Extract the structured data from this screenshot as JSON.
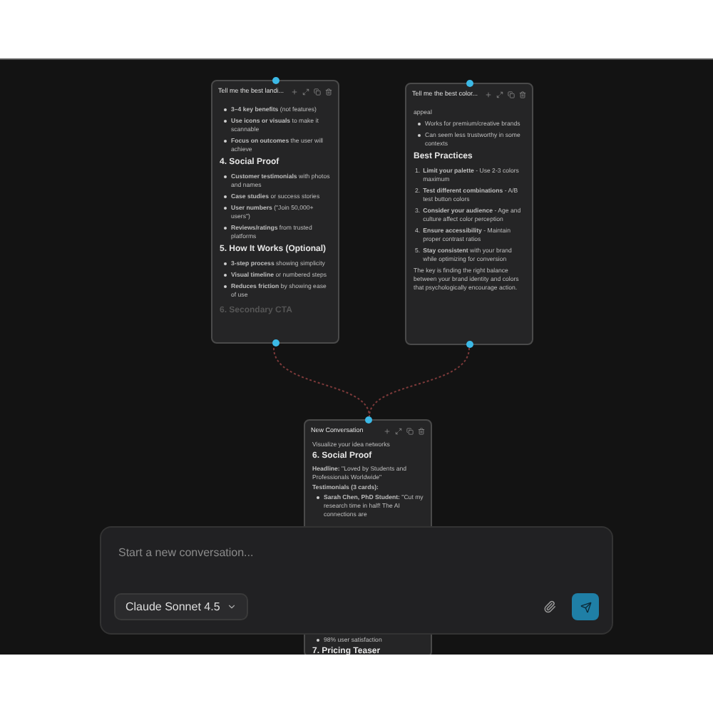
{
  "nodes": [
    {
      "title": "Tell me the best landi...",
      "blocks": [
        {
          "kind": "bullet",
          "text": "**3–4 key benefits** (not features)"
        },
        {
          "kind": "bullet",
          "text": "**Use icons or visuals** to make it scannable"
        },
        {
          "kind": "bullet",
          "text": "**Focus on outcomes** the user will achieve"
        },
        {
          "kind": "heading",
          "text": "4. Social Proof"
        },
        {
          "kind": "bullet",
          "text": "**Customer testimonials** with photos and names"
        },
        {
          "kind": "bullet",
          "text": "**Case studies** or success stories"
        },
        {
          "kind": "bullet",
          "text": "**User numbers** (\"Join 50,000+ users\")"
        },
        {
          "kind": "bullet",
          "text": "**Reviews/ratings** from trusted platforms"
        },
        {
          "kind": "heading",
          "text": "5. How It Works (Optional)"
        },
        {
          "kind": "bullet",
          "text": "**3-step process** showing simplicity"
        },
        {
          "kind": "bullet",
          "text": "**Visual timeline** or numbered steps"
        },
        {
          "kind": "bullet",
          "text": "**Reduces friction** by showing ease of use"
        },
        {
          "kind": "faded",
          "text": "6. Secondary CTA"
        }
      ]
    },
    {
      "title": "Tell me the best color...",
      "blocks": [
        {
          "kind": "para",
          "text": "appeal"
        },
        {
          "kind": "bullet",
          "text": "Works for premium/creative brands"
        },
        {
          "kind": "bullet",
          "text": "Can seem less trustworthy in some contexts"
        },
        {
          "kind": "heading",
          "text": "Best Practices"
        },
        {
          "kind": "numbered",
          "number": "1.",
          "text": "**Limit your palette** - Use 2-3 colors maximum"
        },
        {
          "kind": "numbered",
          "number": "2.",
          "text": "**Test different combinations** - A/B test button colors"
        },
        {
          "kind": "numbered",
          "number": "3.",
          "text": "**Consider your audience** - Age and culture affect color perception"
        },
        {
          "kind": "numbered",
          "number": "4.",
          "text": "**Ensure accessibility** - Maintain proper contrast ratios"
        },
        {
          "kind": "numbered",
          "number": "5.",
          "text": "**Stay consistent** with your brand while optimizing for conversion"
        },
        {
          "kind": "para",
          "text": "The key is finding the right balance between your brand identity and colors that psychologically encourage action."
        }
      ]
    },
    {
      "title": "New Conversation",
      "blocks": [
        {
          "kind": "para",
          "text": "Visualize your idea networks"
        },
        {
          "kind": "heading",
          "text": "6. Social Proof"
        },
        {
          "kind": "para",
          "text": "**Headline:** \"Loved by Students and Professionals Worldwide\""
        },
        {
          "kind": "para",
          "text": "**Testimonials (3 cards):**"
        },
        {
          "kind": "bullet",
          "text": "**Sarah Chen, PhD Student:** \"Cut my research time in half! The AI connections are"
        },
        {
          "kind": "gap"
        },
        {
          "kind": "bullet",
          "text": "98% user satisfaction"
        },
        {
          "kind": "heading",
          "text": "7. Pricing Teaser"
        }
      ]
    }
  ],
  "composer": {
    "placeholder": "Start a new conversation...",
    "model": "Claude Sonnet 4.5"
  }
}
